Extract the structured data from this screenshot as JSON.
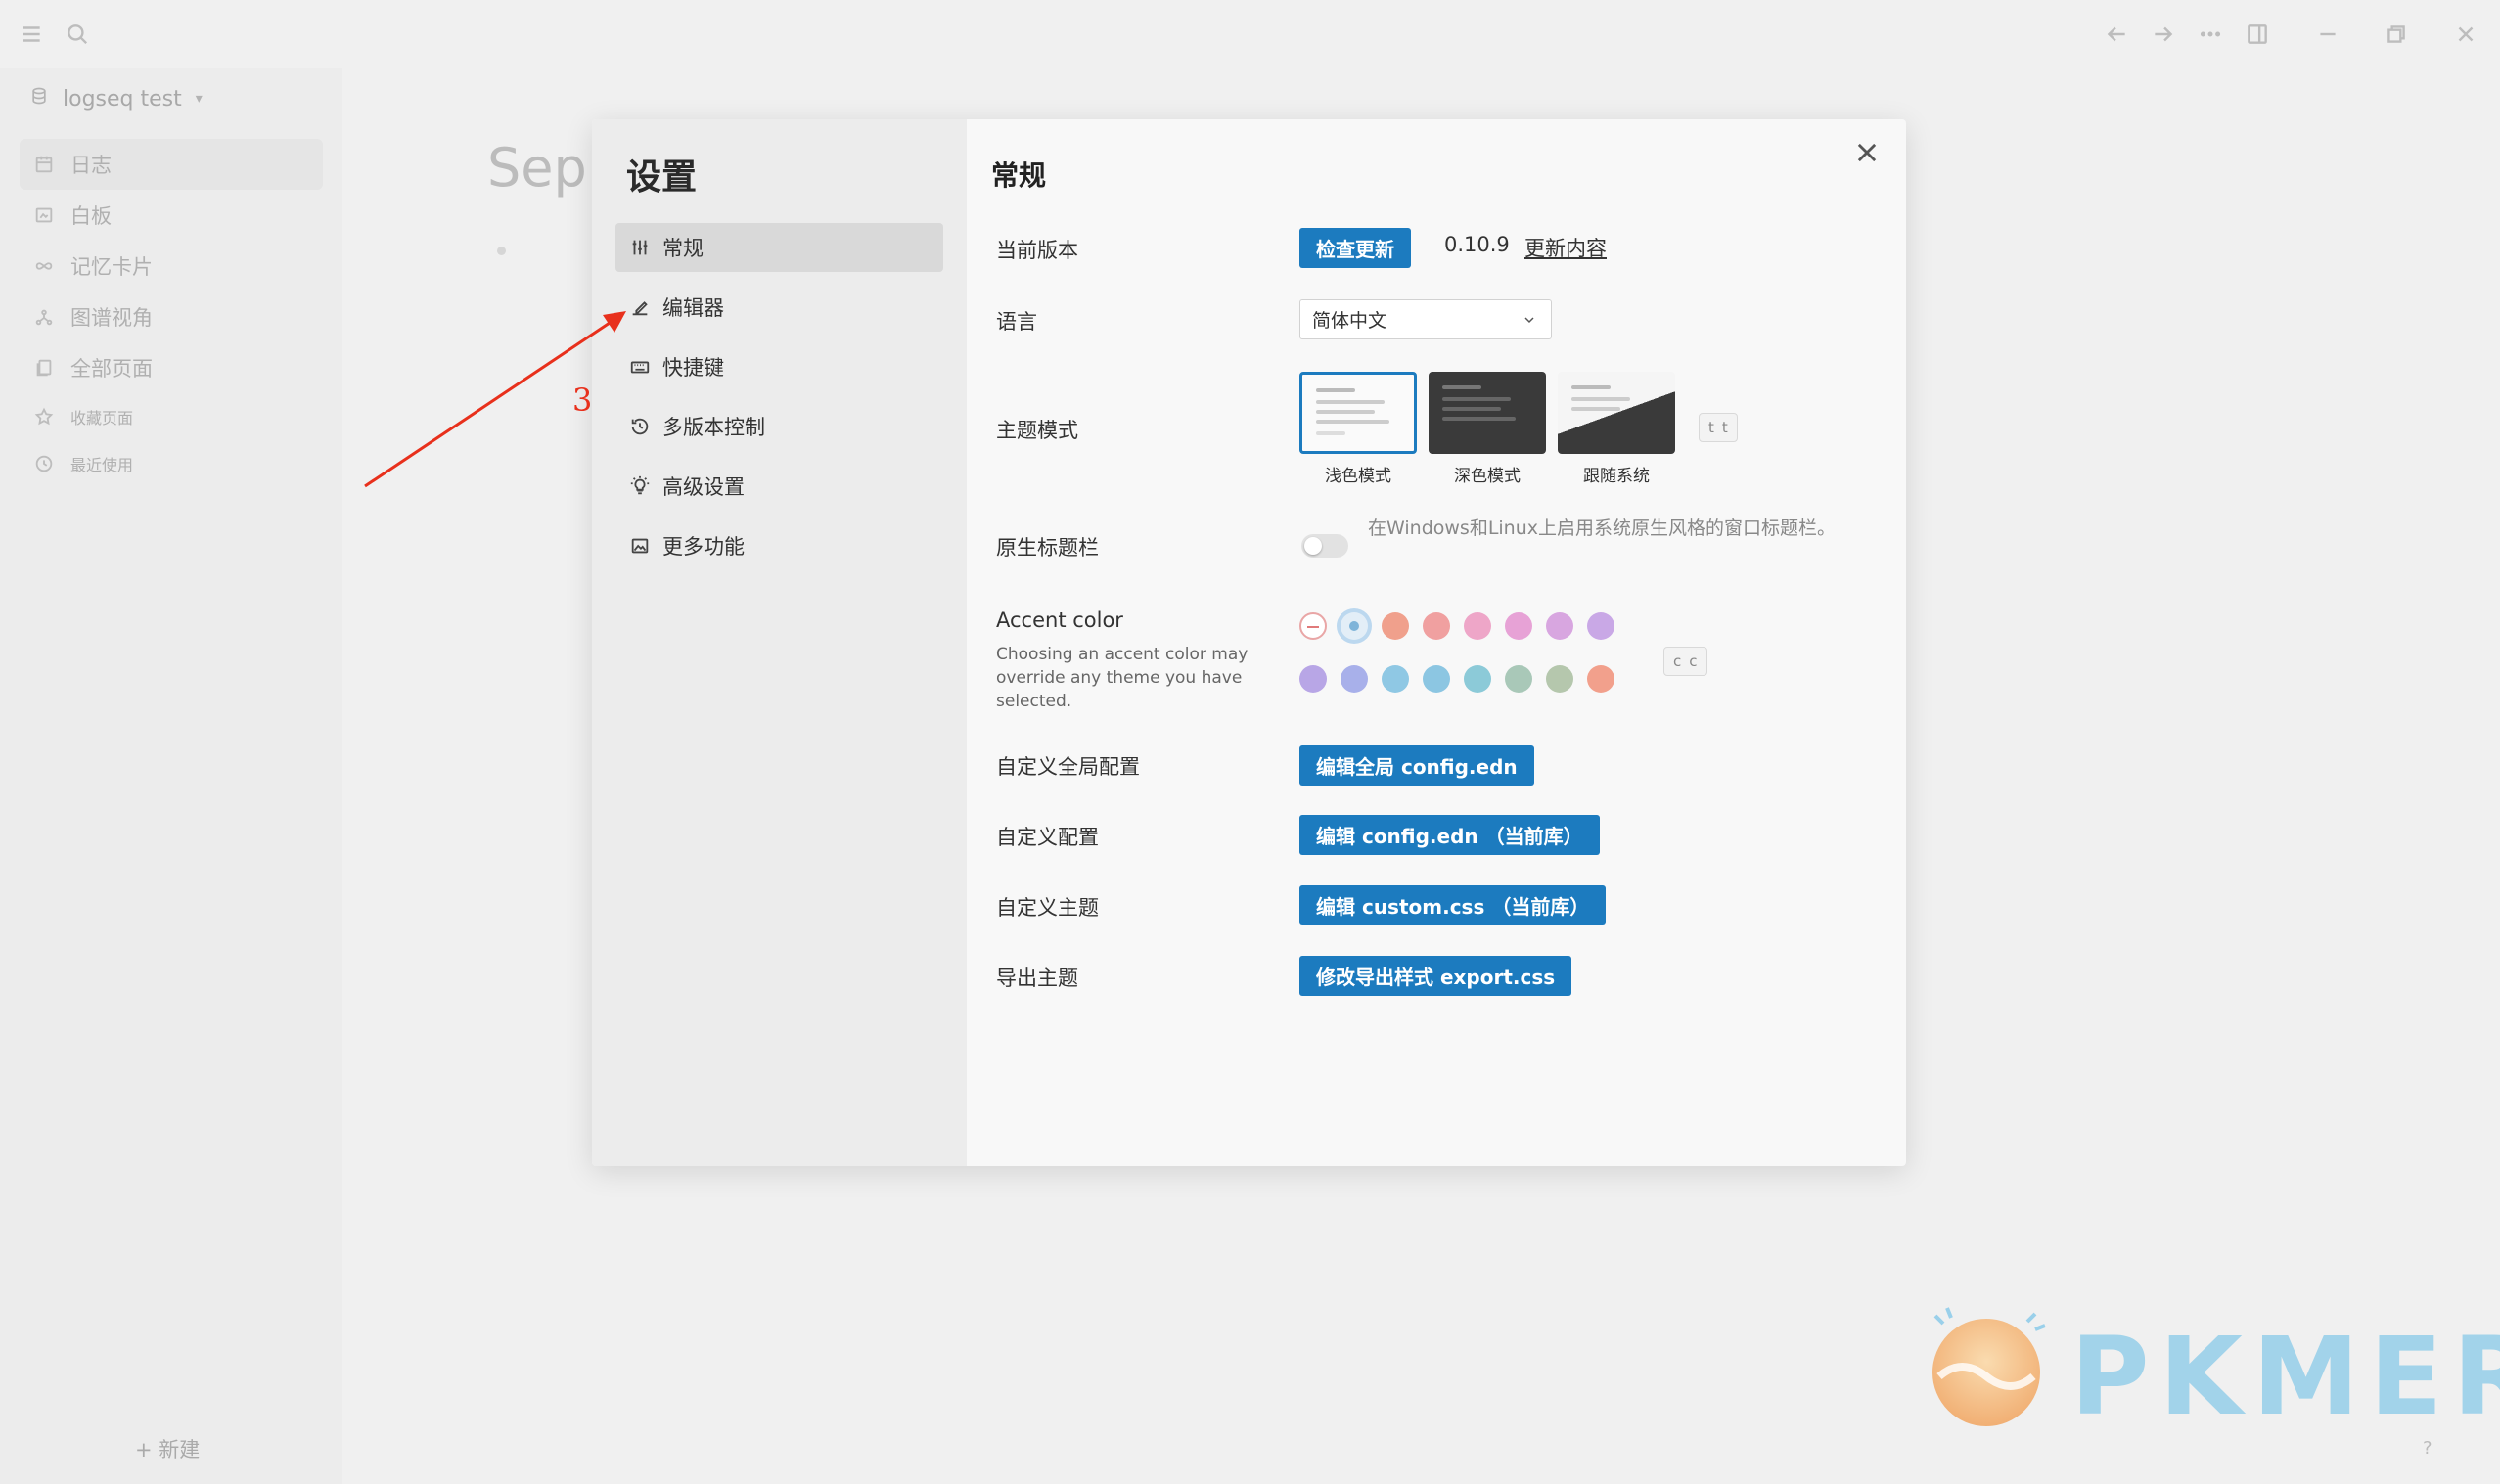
{
  "graph": {
    "name": "logseq test"
  },
  "sidebar": {
    "items": [
      {
        "label": "日志",
        "icon": "calendar-icon"
      },
      {
        "label": "白板",
        "icon": "whiteboard-icon"
      },
      {
        "label": "记忆卡片",
        "icon": "infinity-icon"
      },
      {
        "label": "图谱视角",
        "icon": "graph-icon"
      },
      {
        "label": "全部页面",
        "icon": "pages-icon"
      }
    ],
    "favorites_label": "收藏页面",
    "recent_label": "最近使用",
    "new_label": "+ 新建"
  },
  "page": {
    "title": "Sep"
  },
  "settings": {
    "title": "设置",
    "nav": [
      {
        "label": "常规",
        "icon": "sliders-icon"
      },
      {
        "label": "编辑器",
        "icon": "editor-icon"
      },
      {
        "label": "快捷键",
        "icon": "keyboard-icon"
      },
      {
        "label": "多版本控制",
        "icon": "history-icon"
      },
      {
        "label": "高级设置",
        "icon": "bulb-icon"
      },
      {
        "label": "更多功能",
        "icon": "image-icon"
      }
    ],
    "general": {
      "title": "常规",
      "version_label": "当前版本",
      "check_update": "检查更新",
      "version": "0.10.9",
      "changelog": "更新内容",
      "language_label": "语言",
      "language_value": "简体中文",
      "theme_label": "主题模式",
      "themes": [
        "浅色模式",
        "深色模式",
        "跟随系统"
      ],
      "theme_shortcut": [
        "t",
        "t"
      ],
      "native_titlebar_label": "原生标题栏",
      "native_titlebar_desc": "在Windows和Linux上启用系统原生风格的窗口标题栏。",
      "accent_title": "Accent color",
      "accent_desc": "Choosing an accent color may override any theme you have selected.",
      "accent_shortcut": [
        "c",
        "c"
      ],
      "global_config_label": "自定义全局配置",
      "global_config_btn": "编辑全局 config.edn",
      "config_label": "自定义配置",
      "config_btn": "编辑 config.edn （当前库）",
      "custom_theme_label": "自定义主题",
      "custom_theme_btn": "编辑 custom.css （当前库）",
      "export_theme_label": "导出主题",
      "export_theme_btn": "修改导出样式 export.css"
    }
  },
  "accent_colors": {
    "row1": [
      "#f0a08c",
      "#f0a0a0",
      "#eea6c8",
      "#e7a2d6",
      "#d8a6e0",
      "#c9a8e6"
    ],
    "row2": [
      "#b8a6e6",
      "#a8b0ea",
      "#8fc8e4",
      "#8cc6e2",
      "#8ccad8",
      "#a9c8b8",
      "#b5c7ad",
      "#f2a08c"
    ],
    "selected": "#7fb4d9"
  },
  "annotation": {
    "number": "3",
    "color": "#e8301c"
  },
  "watermark": {
    "text": "PKMER"
  },
  "help": "?"
}
